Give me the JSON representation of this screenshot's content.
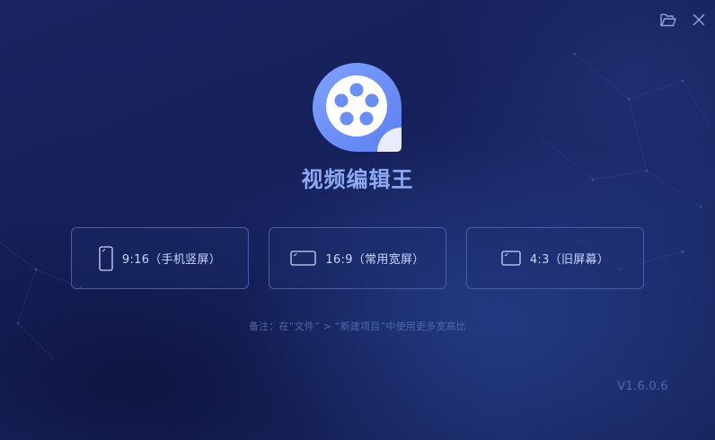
{
  "window": {
    "title": "视频编辑王",
    "icons": [
      "folder-open-icon",
      "close-icon"
    ]
  },
  "ratios": [
    {
      "label": "9:16（手机竖屏）",
      "icon": "portrait-frame-icon"
    },
    {
      "label": "16:9（常用宽屏）",
      "icon": "widescreen-frame-icon"
    },
    {
      "label": "4:3（旧屏幕）",
      "icon": "standard-frame-icon"
    }
  ],
  "note": "备注：在“文件” > “新建项目”中使用更多宽高比",
  "version": "V1.6.0.6",
  "colors": {
    "background": "#1a2460",
    "accent": "#8fa8f2",
    "logo_blue": "#6a8ef5",
    "button_border": "#4a5ba8"
  }
}
